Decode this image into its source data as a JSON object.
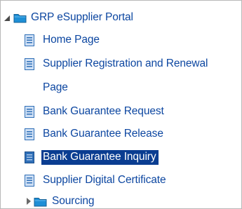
{
  "tree": {
    "root": {
      "label": "GRP eSupplier Portal",
      "icon": "folder-icon",
      "expanded": true
    },
    "items": [
      {
        "label": "Home Page",
        "icon": "document-icon"
      },
      {
        "label": "Supplier Registration and Renewal",
        "label_continued": "Page",
        "icon": "document-icon"
      },
      {
        "label": "Bank Guarantee Request",
        "icon": "document-icon"
      },
      {
        "label": "Bank Guarantee Release",
        "icon": "document-icon"
      },
      {
        "label": "Bank Guarantee Inquiry",
        "icon": "document-icon",
        "selected": true
      },
      {
        "label": "Supplier Digital Certificate",
        "icon": "document-icon"
      }
    ],
    "subfolder": {
      "label": "Sourcing",
      "icon": "folder-icon",
      "expanded": false
    }
  },
  "colors": {
    "link_text": "#0d47a1",
    "selected_background": "#0a3d91",
    "selected_text": "#ffffff",
    "folder": "#1e8fd6",
    "document": "#2f6fb7"
  }
}
